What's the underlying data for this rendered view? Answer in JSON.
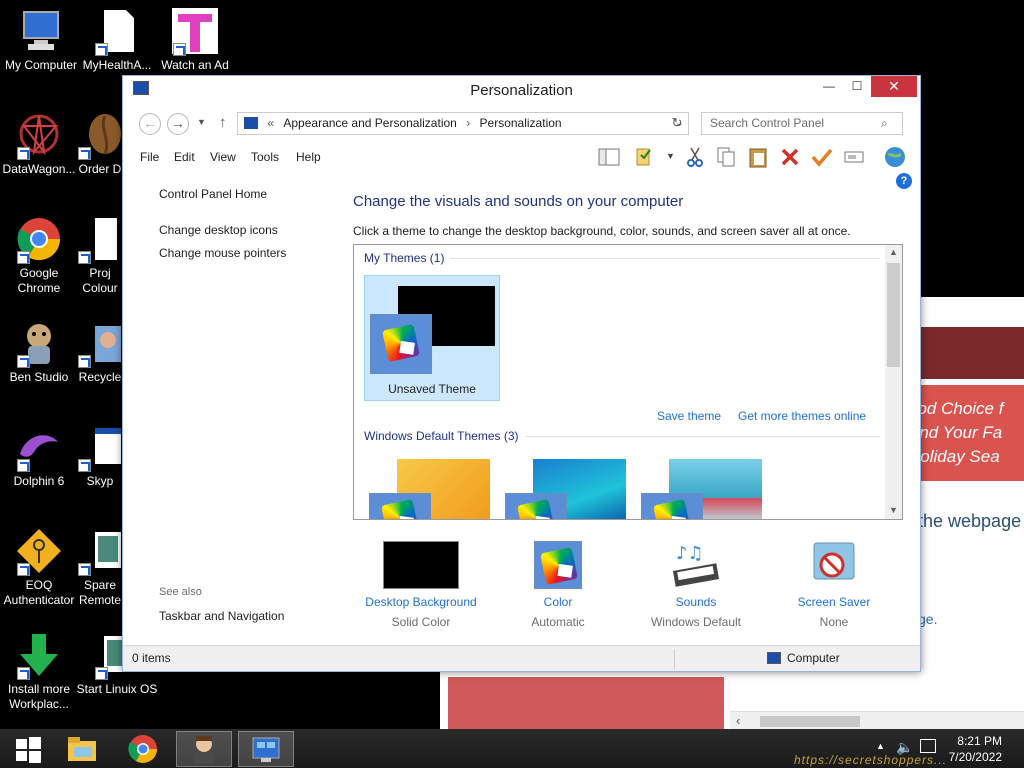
{
  "desktop": {
    "icons": [
      {
        "label": "My Computer"
      },
      {
        "label": "MyHealthA..."
      },
      {
        "label": "Watch an Ad"
      },
      {
        "label": "DataWagon..."
      },
      {
        "label": "Order D"
      },
      {
        "label": "Google Chrome"
      },
      {
        "label": "Proj Colour"
      },
      {
        "label": "Ben Studio"
      },
      {
        "label": "Recycle"
      },
      {
        "label": "Dolphin 6"
      },
      {
        "label": "Skyp"
      },
      {
        "label": "EOQ Authenticator"
      },
      {
        "label": "Spare Remote"
      },
      {
        "label": "Install more Workplac..."
      },
      {
        "label": "Start Linuix OS"
      }
    ]
  },
  "background_page": {
    "promo_lines": [
      "ood Choice f",
      "And Your Fa",
      "Holiday Sea"
    ],
    "webpage_text": "the webpage",
    "link_fragment": "ge."
  },
  "window": {
    "title": "Personalization",
    "buttons": {
      "minimize": "—",
      "maximize": "☐",
      "close": "✕"
    },
    "address": {
      "chevrons": "«",
      "crumb1": "Appearance and Personalization",
      "sep": "›",
      "crumb2": "Personalization"
    },
    "search_placeholder": "Search Control Panel",
    "menu": [
      "File",
      "Edit",
      "View",
      "Tools",
      "Help"
    ],
    "sidebar": {
      "home": "Control Panel Home",
      "links": [
        "Change desktop icons",
        "Change mouse pointers"
      ],
      "see_also_label": "See also",
      "see_also_links": [
        "Taskbar and Navigation"
      ]
    },
    "content": {
      "heading": "Change the visuals and sounds on your computer",
      "subtext": "Click a theme to change the desktop background, color, sounds, and screen saver all at once.",
      "my_themes_label": "My Themes (1)",
      "unsaved_theme": "Unsaved Theme",
      "save_theme": "Save theme",
      "get_more": "Get more themes online",
      "default_themes_label": "Windows Default Themes (3)"
    },
    "bottom_items": [
      {
        "title": "Desktop Background",
        "value": "Solid Color"
      },
      {
        "title": "Color",
        "value": "Automatic"
      },
      {
        "title": "Sounds",
        "value": "Windows Default"
      },
      {
        "title": "Screen Saver",
        "value": "None"
      }
    ],
    "status": {
      "items": "0 items",
      "location": "Computer"
    }
  },
  "taskbar": {
    "time": "8:21 PM",
    "date": "7/20/2022",
    "watermark": "https://secretshoppers..."
  },
  "colors": {
    "accent": "#1e3287",
    "link": "#1e6fd9",
    "selection": "#cce8ff",
    "close_button": "#c7363f"
  }
}
